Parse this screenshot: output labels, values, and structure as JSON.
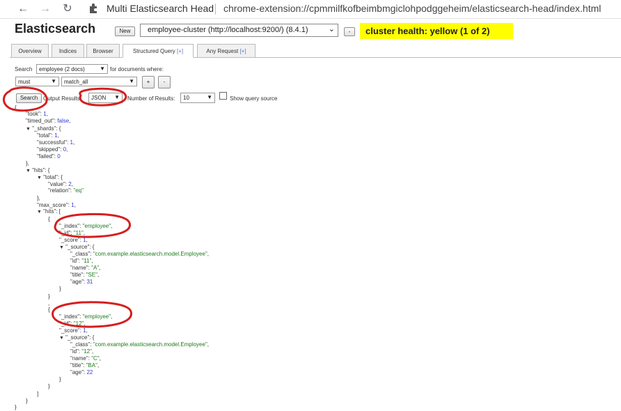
{
  "browser": {
    "tab_title": "Multi Elasticsearch Head",
    "url": "chrome-extension://cpmmilfkofbeimbmgiclohpodggeheim/elasticsearch-head/index.html"
  },
  "app": {
    "title": "Elasticsearch",
    "new_label": "New",
    "cluster": "employee-cluster (http://localhost:9200/) (8.4.1)",
    "remove_label": "-",
    "health": "cluster health: yellow (1 of 2)"
  },
  "tabs": [
    {
      "label": "Overview",
      "plus": ""
    },
    {
      "label": "Indices",
      "plus": ""
    },
    {
      "label": "Browser",
      "plus": ""
    },
    {
      "label": "Structured Query ",
      "plus": "[+]"
    },
    {
      "label": "Any Request ",
      "plus": "[+]"
    }
  ],
  "query": {
    "search_label": "Search",
    "index_value": "employee (2 docs)",
    "for_docs_label": "for documents where:",
    "bool_value": "must",
    "clause_value": "match_all",
    "add_label": "+",
    "remove_label": "-",
    "search_button": "Search",
    "output_label": "Output Results:",
    "output_value": "JSON",
    "num_label": "Number of Results:",
    "num_value": "10",
    "show_source_label": "Show query source"
  },
  "json": {
    "took": "1",
    "timed_out": "false",
    "shards_total": "1",
    "shards_successful": "1",
    "shards_skipped": "0",
    "shards_failed": "0",
    "total_value": "2",
    "total_relation": "\"eq\"",
    "max_score": "1",
    "hit1_index": "\"employee\"",
    "hit1_id": "\"11\"",
    "hit1_score": "1",
    "hit1_class": "\"com.example.elasticsearch.model.Employee\"",
    "hit1_src_id": "\"11\"",
    "hit1_name": "\"A\"",
    "hit1_title": "\"SE\"",
    "hit1_age": "31",
    "hit2_index": "\"employee\"",
    "hit2_id": "\"12\"",
    "hit2_score": "1",
    "hit2_class": "\"com.example.elasticsearch.model.Employee\"",
    "hit2_src_id": "\"12\"",
    "hit2_name": "\"C\"",
    "hit2_title": "\"BA\"",
    "hit2_age": "22"
  },
  "annotation_color": "#d61f1f"
}
